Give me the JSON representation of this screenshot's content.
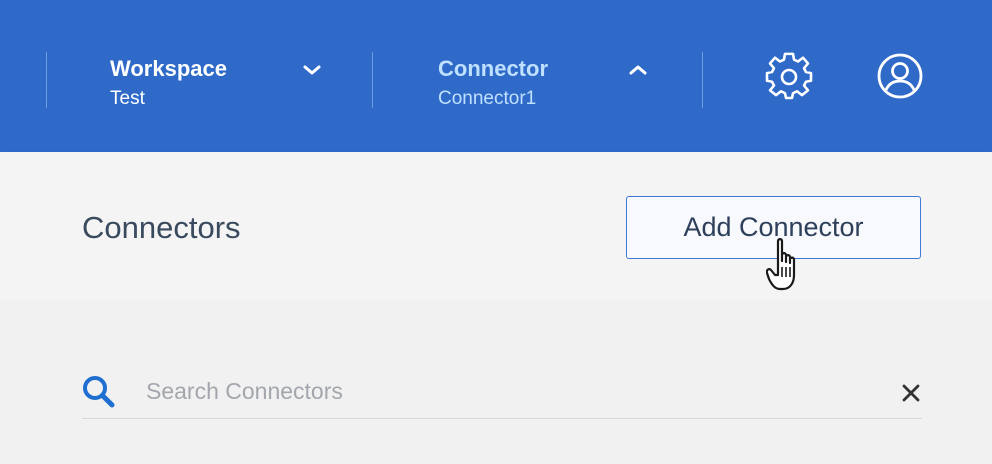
{
  "header": {
    "workspace": {
      "label": "Workspace",
      "value": "Test"
    },
    "connector": {
      "label": "Connector",
      "value": "Connector1"
    },
    "icons": {
      "workspace_toggle": "chevron-down-icon",
      "connector_toggle": "chevron-up-icon",
      "settings": "gear-icon",
      "account": "user-icon"
    }
  },
  "connectors_panel": {
    "title": "Connectors",
    "add_button_label": "Add Connector"
  },
  "search": {
    "placeholder": "Search Connectors",
    "value": "",
    "search_icon": "search-icon",
    "clear_icon": "close-icon"
  },
  "colors": {
    "header_bg": "#2f6ac9",
    "workspace_text": "#ffffff",
    "connector_text": "#bfe0ff",
    "accent": "#1f6fd1",
    "panel_bg": "#f4f4f4",
    "page_bg": "#f1f1f1"
  }
}
